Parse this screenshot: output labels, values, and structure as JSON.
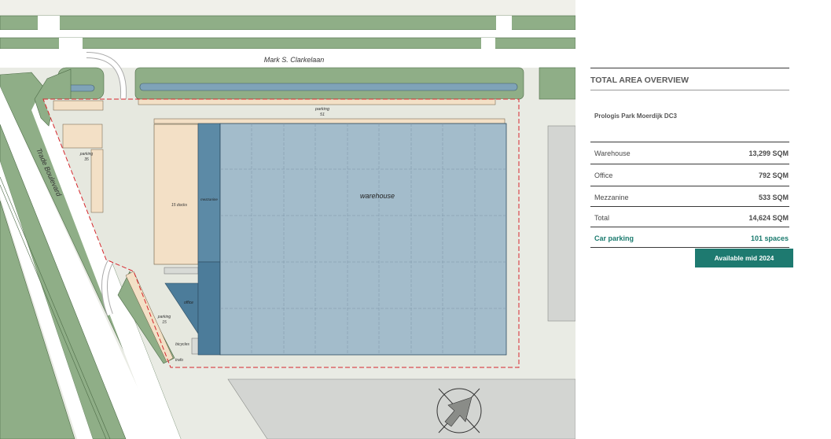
{
  "plan": {
    "street_top": "Mark S. Clarkelaan",
    "street_left": "Trade Boulevard",
    "building_label": "warehouse",
    "docks_label": "15 docks",
    "mezzanine_label": "mezzanine",
    "office_label": "office",
    "bicycles_label": "bicycles",
    "trafo_label": "trafo",
    "parking_top": {
      "label": "parking",
      "count": "51"
    },
    "parking_left": {
      "label": "parking",
      "count": "35"
    },
    "parking_bottom": {
      "label": "parking",
      "count": "15"
    }
  },
  "panel": {
    "title": "TOTAL AREA OVERVIEW",
    "project": "Prologis Park Moerdijk  DC3",
    "rows": [
      {
        "label": "Warehouse",
        "value": "13,299 SQM"
      },
      {
        "label": "Office",
        "value": "792 SQM"
      },
      {
        "label": "Mezzanine",
        "value": "533 SQM"
      },
      {
        "label": "Total",
        "value": "14,624 SQM"
      },
      {
        "label": "Car parking",
        "value": "101 spaces"
      }
    ],
    "availability": "Available mid 2024"
  },
  "colors": {
    "grass": "#8fae87",
    "site_grey": "#e9ebe4",
    "warehouse": "#a3bccb",
    "mezzanine": "#5c8aa6",
    "office": "#4c7c9a",
    "docks": "#f3e0c6",
    "accent": "#1e7a70",
    "boundary": "#d6262c"
  }
}
